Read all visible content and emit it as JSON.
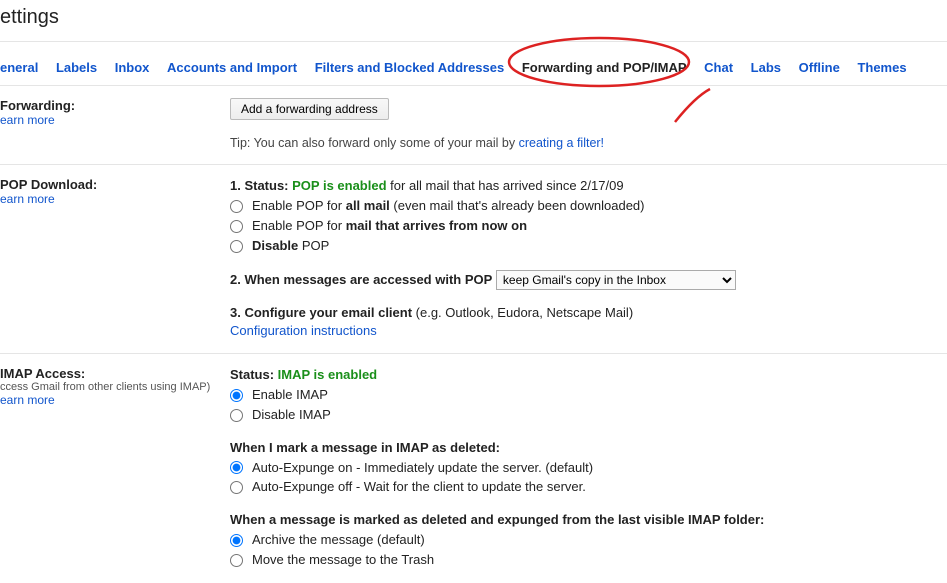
{
  "page": {
    "title": "ettings"
  },
  "tabs": [
    "eneral",
    "Labels",
    "Inbox",
    "Accounts and Import",
    "Filters and Blocked Addresses",
    "Forwarding and POP/IMAP",
    "Chat",
    "Labs",
    "Offline",
    "Themes"
  ],
  "active_tab_index": 5,
  "forwarding": {
    "label": "Forwarding:",
    "learn_more": "earn more",
    "button": "Add a forwarding address",
    "tip_prefix": "Tip: You can also forward only some of your mail by ",
    "tip_link": "creating a filter!"
  },
  "pop": {
    "label": "POP Download:",
    "learn_more": "earn more",
    "status_prefix": "1. Status: ",
    "status_value": "POP is enabled",
    "status_suffix": " for all mail that has arrived since 2/17/09",
    "opt1_prefix": "Enable POP for ",
    "opt1_bold": "all mail",
    "opt1_suffix": " (even mail that's already been downloaded)",
    "opt2_prefix": "Enable POP for ",
    "opt2_bold": "mail that arrives from now on",
    "opt3_bold": "Disable",
    "opt3_suffix": " POP",
    "access_label": "2. When messages are accessed with POP",
    "access_select": "keep Gmail's copy in the Inbox",
    "configure_prefix": "3. Configure your email client",
    "configure_suffix": " (e.g. Outlook, Eudora, Netscape Mail)",
    "config_link": "Configuration instructions"
  },
  "imap": {
    "label": "IMAP Access:",
    "sub": "ccess Gmail from other clients using IMAP)",
    "learn_more": "earn more",
    "status_prefix": "Status: ",
    "status_value": "IMAP is enabled",
    "enable_prefix": "Enable",
    "enable_suffix": " IMAP",
    "disable_prefix": "Disable",
    "disable_suffix": " IMAP",
    "mark_deleted_label": "When I mark a message in IMAP as deleted:",
    "expunge_on": "Auto-Expunge on - Immediately update the server. (default)",
    "expunge_off": "Auto-Expunge off - Wait for the client to update the server.",
    "expunged_label": "When a message is marked as deleted and expunged from the last visible IMAP folder:",
    "archive": "Archive the message (default)",
    "trash": "Move the message to the Trash"
  }
}
